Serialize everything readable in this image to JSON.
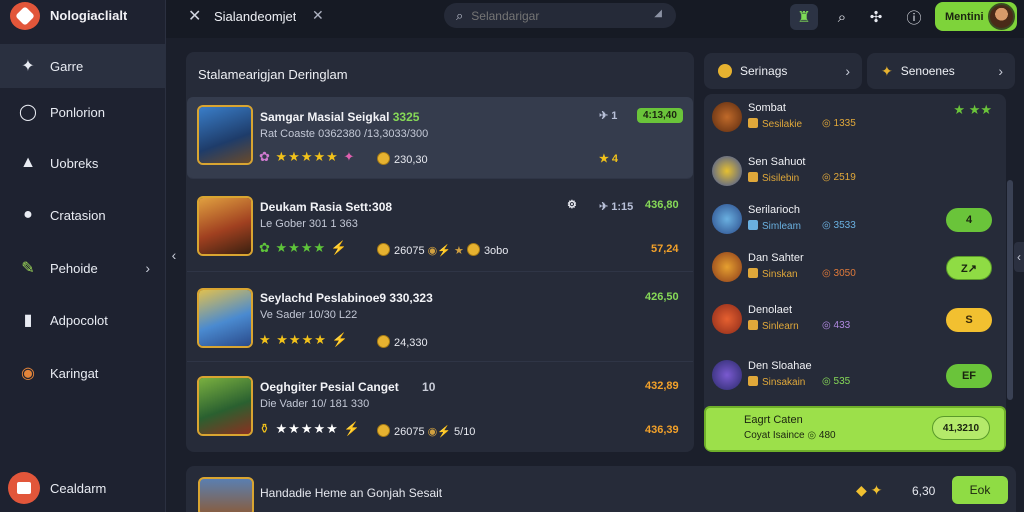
{
  "app": {
    "title": "Nologiaclialt"
  },
  "sidebar": {
    "items": [
      {
        "label": "Garre",
        "icon": "game-controller-icon"
      },
      {
        "label": "Ponlorion",
        "icon": "shield-icon"
      },
      {
        "label": "Uobreks",
        "icon": "trophy-icon"
      },
      {
        "label": "Cratasion",
        "icon": "location-pin-icon"
      },
      {
        "label": "Pehoide",
        "icon": "pencil-icon"
      },
      {
        "label": "Adpocolot",
        "icon": "bookmark-icon"
      },
      {
        "label": "Karingat",
        "icon": "globe-icon"
      }
    ],
    "bottom": {
      "label": "Cealdarm"
    }
  },
  "topbar": {
    "tab_title": "Sialandeomjet",
    "search_placeholder": "Selandarigar",
    "profile_name": "Mentini"
  },
  "panel": {
    "title": "Stalamearigjan Deringlam",
    "rows": [
      {
        "title": "Samgar Masial Seigkal",
        "title_hl": "3325",
        "sub": "Rat Coaste 0362380 /13,3033/300",
        "coins": "230,30",
        "meta": "1",
        "badge": "4:13,40",
        "right": "4"
      },
      {
        "title": "Deukam Rasia Sett:308",
        "title_hl": "",
        "sub": "Le Gober 301 1 363",
        "coins": "26075",
        "extra": "3obo",
        "meta": "1:15",
        "badge_right": "436,80",
        "right": "57,24"
      },
      {
        "title": "Seylachd Peslabinoe9 330,323",
        "title_hl": "",
        "sub": "Ve Sader 10/30 L22",
        "coins": "24,330",
        "right_top": "426,50"
      },
      {
        "title": "Oeghgiter Pesial Canget",
        "title_hl": "",
        "sub": "Die Vader 10/ 181 330",
        "coins": "26075",
        "extra": "5/10",
        "meta": "10",
        "right_top": "432,89",
        "right": "436,39"
      }
    ]
  },
  "bottom_bar": {
    "title": "Handadie Heme an Gonjah Sesait",
    "value": "6,30",
    "button": "Eok"
  },
  "right": {
    "tab1": "Serinags",
    "tab2": "Senoenes",
    "items": [
      {
        "name": "Sombat",
        "sub": "Sesilakie",
        "pts": "1335",
        "btn": ""
      },
      {
        "name": "Sen Sahuot",
        "sub": "Sisilebin",
        "pts": "2519",
        "btn": ""
      },
      {
        "name": "Serilarioch",
        "sub": "Simleam",
        "pts": "3533",
        "btn": "4"
      },
      {
        "name": "Dan Sahter",
        "sub": "Sinskan",
        "pts": "3050",
        "btn": "Z↗"
      },
      {
        "name": "Denolaet",
        "sub": "Sinlearn",
        "pts": "433",
        "btn": "S"
      },
      {
        "name": "Den Sloahae",
        "sub": "Sinsakain",
        "pts": "535",
        "btn": "EF"
      },
      {
        "name": "Eagrt Caten",
        "sub": "Coyat Isaince",
        "pts": "480",
        "btn": "41,3210"
      }
    ]
  },
  "colors": {
    "accent": "#7ed33a",
    "gold": "#e6b230",
    "panel": "#262b39"
  }
}
